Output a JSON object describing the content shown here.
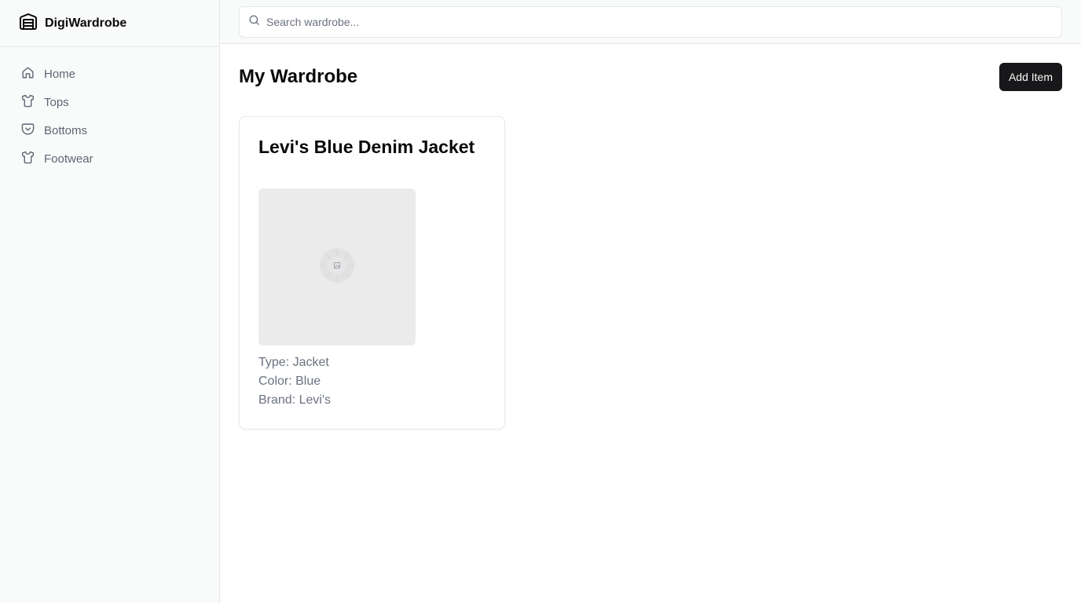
{
  "app": {
    "name": "DigiWardrobe",
    "logo_icon": "wardrobe-icon"
  },
  "sidebar": {
    "items": [
      {
        "label": "Home",
        "icon": "home-icon"
      },
      {
        "label": "Tops",
        "icon": "shirt-icon"
      },
      {
        "label": "Bottoms",
        "icon": "pocket-icon"
      },
      {
        "label": "Footwear",
        "icon": "shirt-icon"
      }
    ]
  },
  "search": {
    "placeholder": "Search wardrobe...",
    "value": ""
  },
  "page": {
    "title": "My Wardrobe",
    "add_button_label": "Add Item"
  },
  "items": [
    {
      "title": "Levi's Blue Denim Jacket",
      "image": "image-placeholder-icon",
      "type": "Type: Jacket",
      "color": "Color: Blue",
      "brand": "Brand: Levi's"
    }
  ],
  "colors": {
    "primary_button": "#18181b",
    "sidebar_bg": "#f9fafa",
    "muted_text": "#6b7280"
  }
}
